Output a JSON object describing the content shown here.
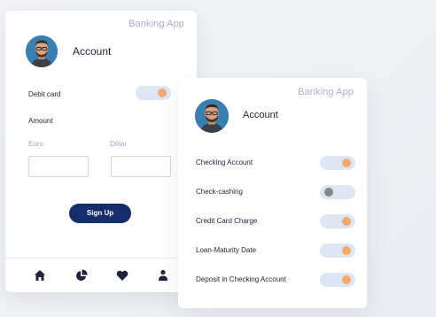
{
  "card_left": {
    "app_title": "Banking App",
    "account_name": "Account",
    "debit_card_label": "Debit card",
    "debit_card_on": true,
    "amount_label": "Amount",
    "euro_label": "Euro",
    "dollar_label": "Dólar",
    "euro_value": "",
    "dollar_value": "",
    "signup_label": "Sign Up",
    "tabs": [
      "home-icon",
      "pie-chart-icon",
      "heart-icon",
      "user-icon"
    ]
  },
  "card_right": {
    "app_title": "Banking App",
    "account_name": "Account",
    "settings": [
      {
        "label": "Checking Account",
        "on": true
      },
      {
        "label": "Check-cashing",
        "on": false
      },
      {
        "label": "Credit Card Charge",
        "on": true
      },
      {
        "label": "Loan-Maturity Date",
        "on": true
      },
      {
        "label": "Deposit in Checking Account",
        "on": true
      }
    ]
  },
  "colors": {
    "accent_orange": "#f3a86f",
    "toggle_track": "#dde7f3",
    "button_navy": "#162d6b",
    "muted_text": "#aab0c6"
  }
}
